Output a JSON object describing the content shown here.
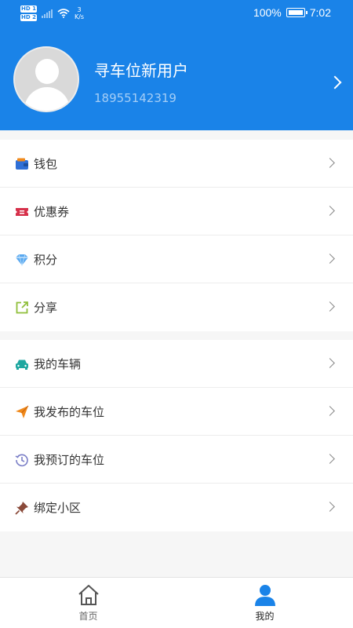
{
  "status_bar": {
    "sim1": "HD 1",
    "sim2": "HD 2",
    "net_speed_value": "3",
    "net_speed_unit": "K/s",
    "battery_percent": "100%",
    "time": "7:02"
  },
  "profile": {
    "name": "寻车位新用户",
    "phone": "18955142319"
  },
  "menu_group_1": [
    {
      "label": "钱包",
      "icon": "wallet-icon",
      "color": "#2f6fd6"
    },
    {
      "label": "优惠券",
      "icon": "coupon-icon",
      "color": "#d6304a"
    },
    {
      "label": "积分",
      "icon": "diamond-icon",
      "color": "#5aa9f0"
    },
    {
      "label": "分享",
      "icon": "share-icon",
      "color": "#8fbf3a"
    }
  ],
  "menu_group_2": [
    {
      "label": "我的车辆",
      "icon": "car-icon",
      "color": "#1ea7a0"
    },
    {
      "label": "我发布的车位",
      "icon": "paper-plane-icon",
      "color": "#f08a1c"
    },
    {
      "label": "我预订的车位",
      "icon": "clock-history-icon",
      "color": "#7b7fc7"
    },
    {
      "label": "绑定小区",
      "icon": "pushpin-icon",
      "color": "#8a4a3a"
    }
  ],
  "tab_bar": {
    "home_label": "首页",
    "mine_label": "我的",
    "active_color": "#1a83e8"
  },
  "colors": {
    "header": "#1a83e8"
  }
}
